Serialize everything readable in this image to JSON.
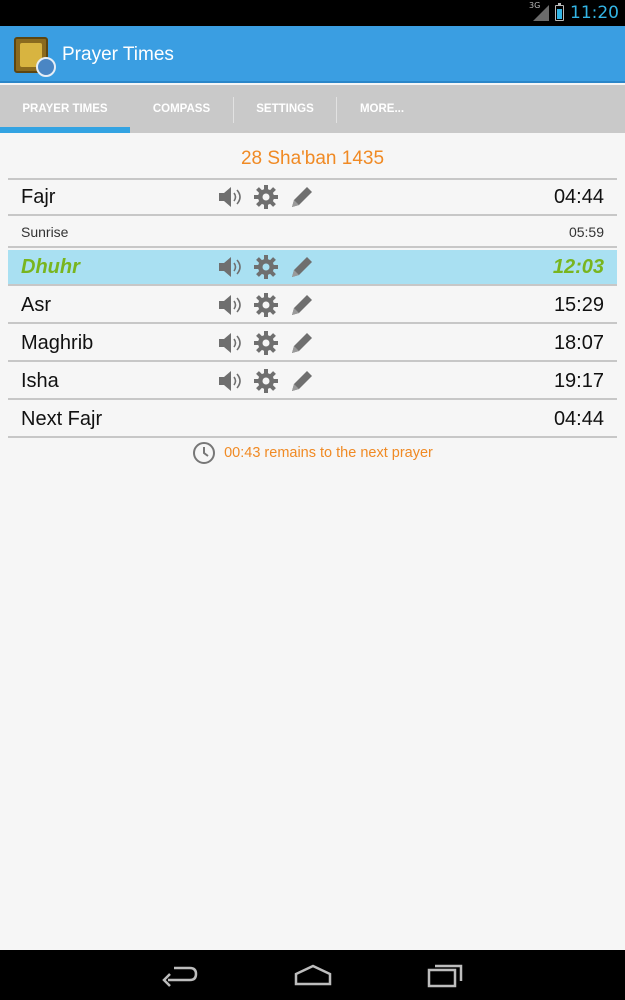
{
  "status_bar": {
    "network": "3G",
    "time": "11:20"
  },
  "app": {
    "title": "Prayer Times"
  },
  "tabs": [
    {
      "label": "PRAYER TIMES",
      "selected": true
    },
    {
      "label": "COMPASS",
      "selected": false
    },
    {
      "label": "SETTINGS",
      "selected": false
    },
    {
      "label": "MORE...",
      "selected": false
    }
  ],
  "hijri_date": "28 Sha'ban 1435",
  "prayers": [
    {
      "name": "Fajr",
      "time": "04:44"
    },
    {
      "name": "Sunrise",
      "time": "05:59"
    },
    {
      "name": "Dhuhr",
      "time": "12:03"
    },
    {
      "name": "Asr",
      "time": "15:29"
    },
    {
      "name": "Maghrib",
      "time": "18:07"
    },
    {
      "name": "Isha",
      "time": "19:17"
    },
    {
      "name": "Next Fajr",
      "time": "04:44"
    }
  ],
  "remaining_text": "00:43 remains to the next prayer",
  "icons": {
    "row_actions": [
      "speaker-icon",
      "gear-icon",
      "pencil-icon"
    ],
    "remaining": "clock-icon",
    "nav": [
      "back-icon",
      "home-icon",
      "recent-apps-icon"
    ]
  },
  "colors": {
    "action_bar": "#3a9ee2",
    "accent_orange": "#f08a24",
    "active_row": "#a9e0f2",
    "active_text": "#79b51e",
    "tab_indicator": "#33a3e2"
  }
}
